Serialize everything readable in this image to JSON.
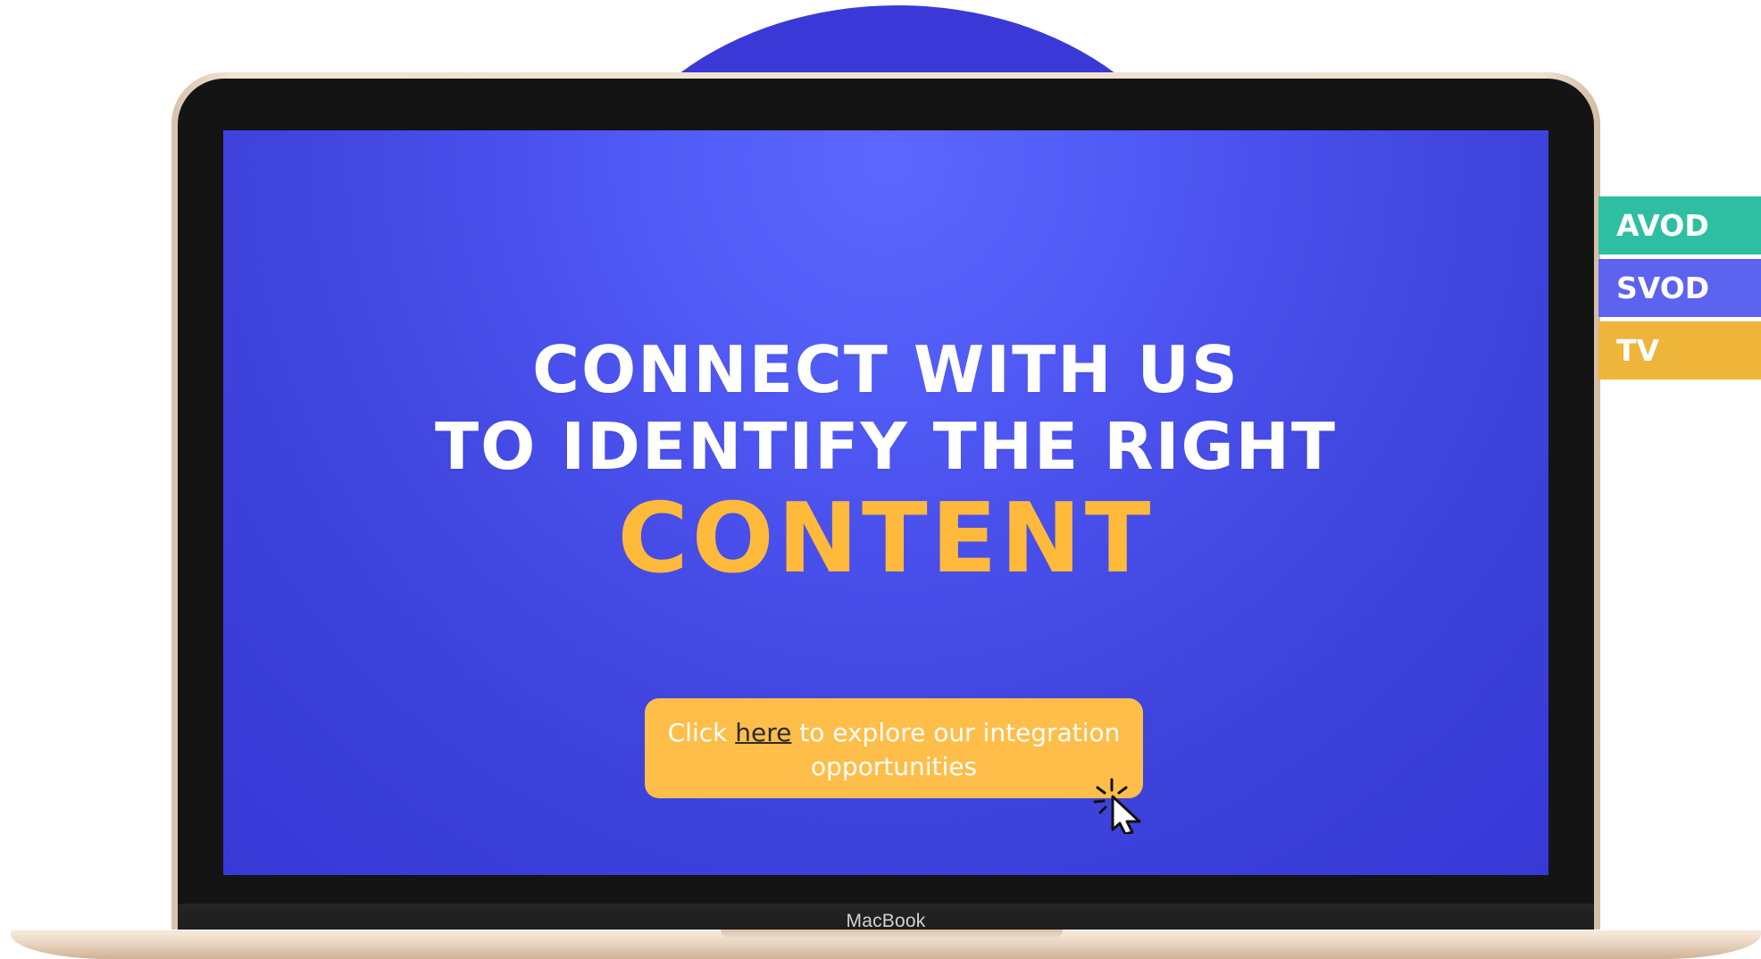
{
  "device": {
    "brand_label": "MacBook"
  },
  "hero": {
    "line_1": "CONNECT WITH US",
    "line_2": "TO IDENTIFY THE RIGHT",
    "accent_word": "CONTENT",
    "cta_prefix": "Click ",
    "cta_link_text": "here",
    "cta_suffix": " to explore our integration opportunities"
  },
  "channels": [
    {
      "label": "AVOD",
      "color": "#2ebea1"
    },
    {
      "label": "SVOD",
      "color": "#5b63ef"
    },
    {
      "label": "TV",
      "color": "#efb43a"
    }
  ],
  "icons": {
    "cursor": "cursor-click-icon"
  },
  "colors": {
    "dome": "#3a39d7",
    "screen_accent": "#ffb93b",
    "cta_background": "#ffbe4a",
    "cta_text": "#ffffff",
    "link_text": "#2b2b2b"
  }
}
